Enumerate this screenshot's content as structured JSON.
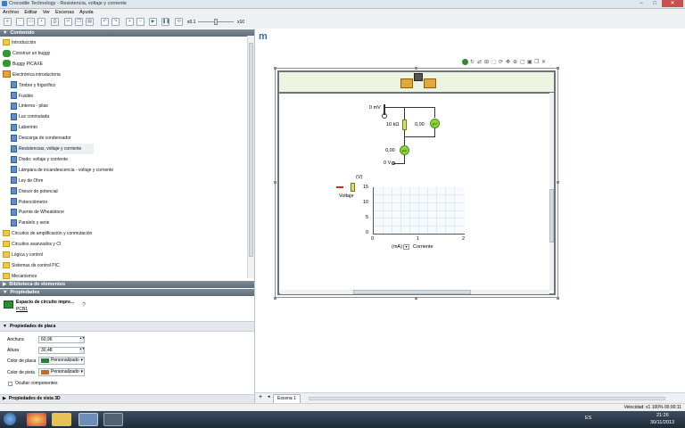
{
  "window": {
    "title": "Crocodile Technology - Resistencia, voltaje y corriente",
    "min": "–",
    "max": "□",
    "close": "✕"
  },
  "menu": [
    "Archivo",
    "Editar",
    "Ver",
    "Escenas",
    "Ayuda"
  ],
  "toolbar": {
    "zoom_min": "x0.1",
    "zoom_max": "x10"
  },
  "left": {
    "contents_header": "Contenido",
    "tree": [
      {
        "label": "Introducción",
        "icon": "folder"
      },
      {
        "label": "Construir un buggy",
        "icon": "buggy"
      },
      {
        "label": "Buggy PICAXE",
        "icon": "buggy"
      },
      {
        "label": "Electrónica introductoria",
        "icon": "elec"
      },
      {
        "label": "Timbre y frigorífico",
        "icon": "page"
      },
      {
        "label": "Fusible",
        "icon": "page"
      },
      {
        "label": "Linterna - pilas",
        "icon": "page"
      },
      {
        "label": "Luz conmutada",
        "icon": "page"
      },
      {
        "label": "Laberinto",
        "icon": "page"
      },
      {
        "label": "Descarga de condensador",
        "icon": "page"
      },
      {
        "label": "Resistencias, voltaje y corriente",
        "icon": "page"
      },
      {
        "label": "Diodo: voltaje y corriente",
        "icon": "page"
      },
      {
        "label": "Lámpara de incandescencia - voltaje y corriente",
        "icon": "page"
      },
      {
        "label": "Ley de Ohm",
        "icon": "page"
      },
      {
        "label": "Divisor de potencial",
        "icon": "page"
      },
      {
        "label": "Potenciómetro",
        "icon": "page"
      },
      {
        "label": "Puente de Wheatstone",
        "icon": "page"
      },
      {
        "label": "Paralelo y serie",
        "icon": "page"
      },
      {
        "label": "Circuitos de amplificación y conmutación",
        "icon": "folder"
      },
      {
        "label": "Circuitos avanzados y CI",
        "icon": "folder"
      },
      {
        "label": "Lógica y control",
        "icon": "folder"
      },
      {
        "label": "Sistemas de control PIC",
        "icon": "folder"
      },
      {
        "label": "Mecanismos",
        "icon": "folder"
      }
    ],
    "library_header": "Biblioteca de elementos",
    "properties_header": "Propiedades",
    "object_name": "Espacio de circuito impre...",
    "object_id": "PCB1",
    "help": "?",
    "board_props_header": "Propiedades de placa",
    "width_label": "Anchura",
    "width_value": "60,96",
    "height_label": "Altura",
    "height_value": "30,48",
    "board_color_label": "Color de placa",
    "board_color_value": "Personalizado",
    "board_color": "#2f7d32",
    "track_color_label": "Color de pista",
    "track_color_value": "Personalizado",
    "track_color": "#c06a2a",
    "hide_components_label": "Ocultar componentes",
    "view3d_header": "Propiedades de vista 3D"
  },
  "circuit": {
    "source_top": "0 mV",
    "resistor": "10 kΩ",
    "voltmeter_reading": "0,00",
    "voltmeter_unit": "µV",
    "ammeter_reading": "0,00",
    "ammeter_unit": "µA",
    "ground": "0 V"
  },
  "graph": {
    "y_unit": "(V)",
    "legend": "Voltaje",
    "y_ticks": [
      "15",
      "10",
      "5",
      "0"
    ],
    "x_ticks": [
      "0",
      "1",
      "2"
    ],
    "x_unit": "(mA)",
    "x_label": "Corriente",
    "accent": "#d22"
  },
  "scene_tab": "Escena 1",
  "status": "Velocidad: x1  100%   00:00:11",
  "taskbar": {
    "lang": "ES",
    "time": "21:26",
    "date": "30/11/2013"
  }
}
